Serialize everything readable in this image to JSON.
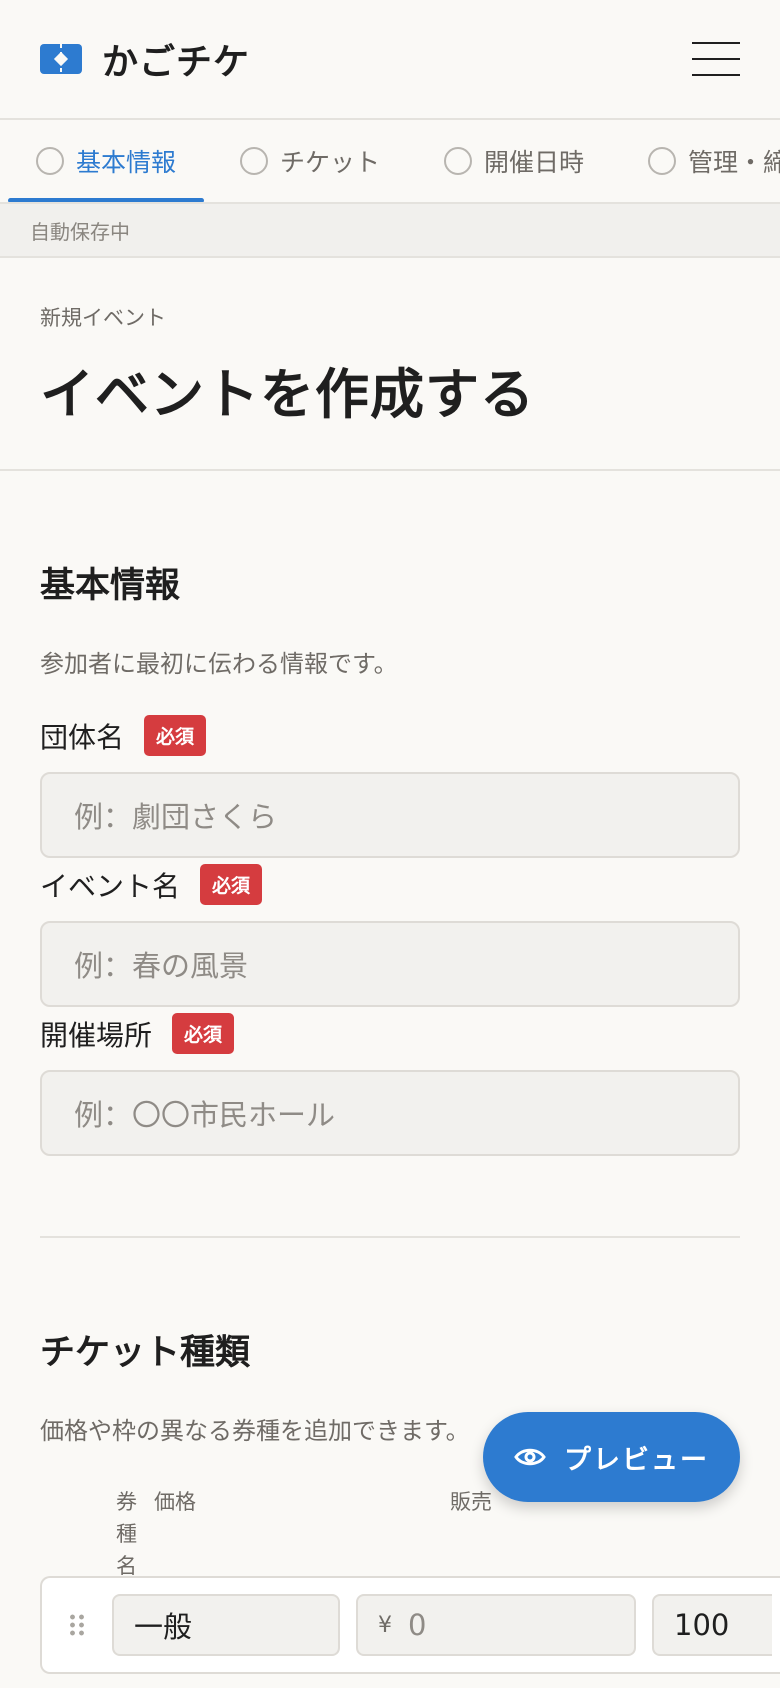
{
  "header": {
    "logo_icon": "ticket-icon",
    "brand_name": "かごチケ",
    "menu_icon": "hamburger-menu-icon"
  },
  "steps": [
    {
      "label": "基本情報",
      "active": true
    },
    {
      "label": "チケット",
      "active": false
    },
    {
      "label": "開催日時",
      "active": false
    },
    {
      "label": "管理・締切",
      "active": false
    }
  ],
  "autosave_status": "自動保存中",
  "page": {
    "eyebrow": "新規イベント",
    "title": "イベントを作成する"
  },
  "basic_info": {
    "title": "基本情報",
    "description": "参加者に最初に伝わる情報です。",
    "required_badge": "必須",
    "fields": [
      {
        "label": "団体名",
        "placeholder": "例：劇団さくら"
      },
      {
        "label": "イベント名",
        "placeholder": "例：春の風景"
      },
      {
        "label": "開催場所",
        "placeholder": "例：〇〇市民ホール"
      }
    ]
  },
  "tickets": {
    "title": "チケット種類",
    "description": "価格や枠の異なる券種を追加できます。",
    "columns": {
      "name": "券種名",
      "price": "価格",
      "sales": "販売"
    },
    "rows": [
      {
        "name": "一般",
        "currency": "¥",
        "price_placeholder": "0",
        "quantity": "100"
      }
    ]
  },
  "preview_button": {
    "icon": "eye-icon",
    "label": "プレビュー"
  },
  "colors": {
    "accent": "#2d7bd0",
    "required": "#d53c3f",
    "background": "#faf9f6"
  }
}
